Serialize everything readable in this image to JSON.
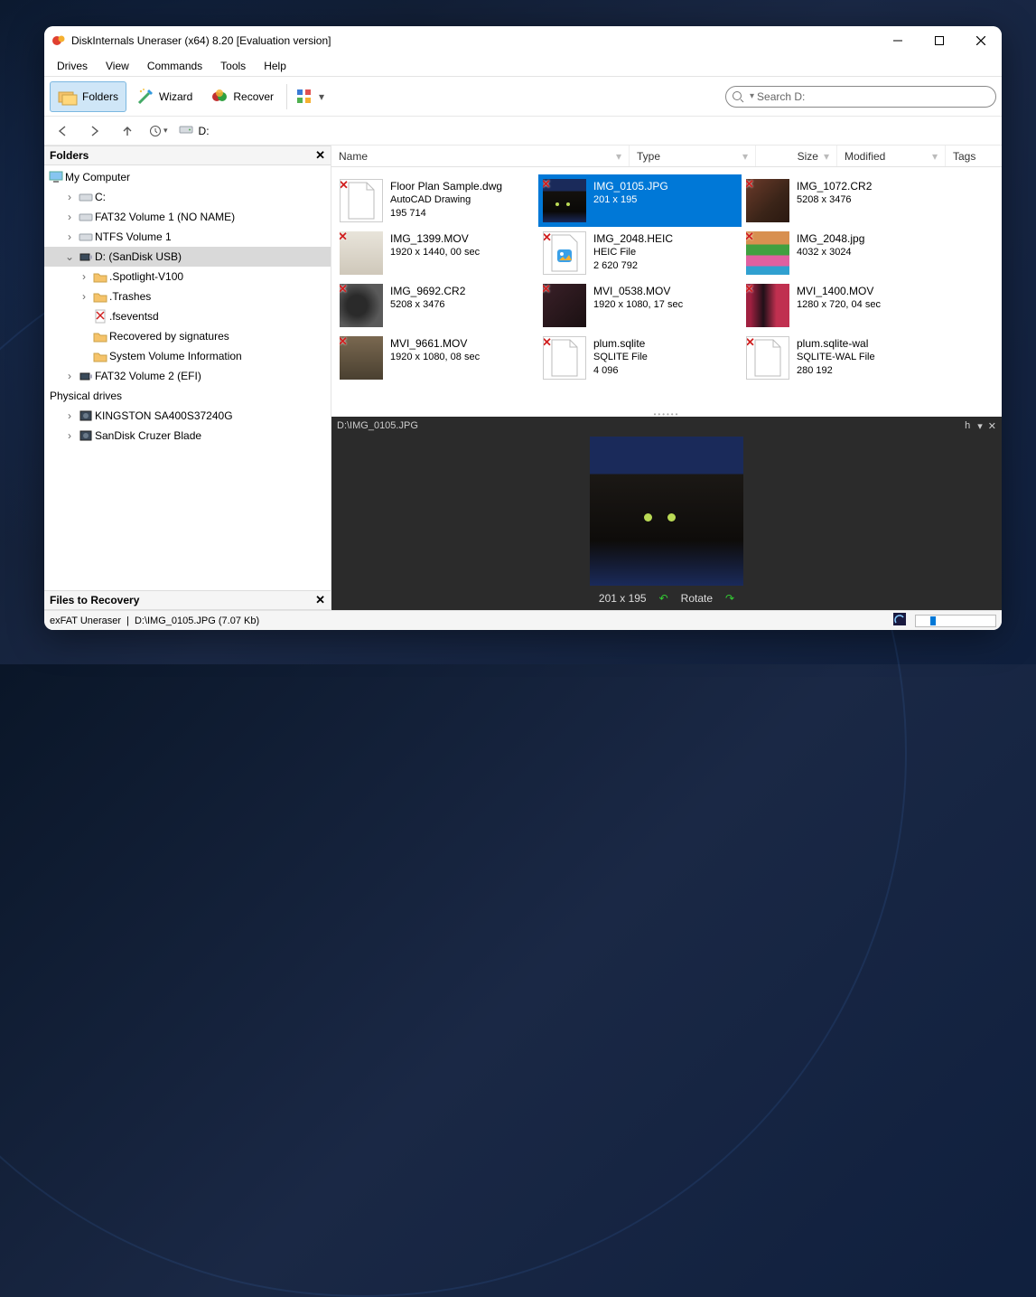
{
  "window": {
    "title": "DiskInternals Uneraser (x64) 8.20 [Evaluation version]"
  },
  "menu": {
    "drives": "Drives",
    "view": "View",
    "commands": "Commands",
    "tools": "Tools",
    "help": "Help"
  },
  "toolbar": {
    "folders": "Folders",
    "wizard": "Wizard",
    "recover": "Recover",
    "search_placeholder": "Search D:"
  },
  "nav": {
    "path": "D:"
  },
  "sidebar": {
    "folders_title": "Folders",
    "recovery_title": "Files to Recovery",
    "phys_title": "Physical drives",
    "tree": {
      "my_computer": "My Computer",
      "c": "C:",
      "fat32_v1": "FAT32 Volume 1 (NO NAME)",
      "ntfs_v1": "NTFS Volume 1",
      "d": "D: (SanDisk USB)",
      "spotlight": ".Spotlight-V100",
      "trashes": ".Trashes",
      "fseventsd": ".fseventsd",
      "sigs": "Recovered by signatures",
      "svi": "System Volume Information",
      "fat32_v2": "FAT32 Volume 2 (EFI)",
      "kingston": "KINGSTON SA400S37240G",
      "sandisk": "SanDisk Cruzer Blade"
    }
  },
  "columns": {
    "name": "Name",
    "type": "Type",
    "size": "Size",
    "modified": "Modified",
    "tags": "Tags"
  },
  "files": [
    {
      "name": "Floor Plan Sample.dwg",
      "line2": "AutoCAD Drawing",
      "line3": "195 714",
      "thumb": "doc"
    },
    {
      "name": "IMG_0105.JPG",
      "line2": "201 x 195",
      "line3": "",
      "thumb": "cat",
      "selected": true
    },
    {
      "name": "IMG_1072.CR2",
      "line2": "5208 x 3476",
      "line3": "",
      "thumb": "photo1"
    },
    {
      "name": "IMG_1399.MOV",
      "line2": "1920 x 1440, 00 sec",
      "line3": "",
      "thumb": "photo2"
    },
    {
      "name": "IMG_2048.HEIC",
      "line2": "HEIC File",
      "line3": "2 620 792",
      "thumb": "heic"
    },
    {
      "name": "IMG_2048.jpg",
      "line2": "4032 x 3024",
      "line3": "",
      "thumb": "photo3"
    },
    {
      "name": "IMG_9692.CR2",
      "line2": "5208 x 3476",
      "line3": "",
      "thumb": "photo4"
    },
    {
      "name": "MVI_0538.MOV",
      "line2": "1920 x 1080, 17 sec",
      "line3": "",
      "thumb": "photo5"
    },
    {
      "name": "MVI_1400.MOV",
      "line2": "1280 x 720, 04 sec",
      "line3": "",
      "thumb": "photo6"
    },
    {
      "name": "MVI_9661.MOV",
      "line2": "1920 x 1080, 08 sec",
      "line3": "",
      "thumb": "photo7"
    },
    {
      "name": "plum.sqlite",
      "line2": "SQLITE File",
      "line3": "4 096",
      "thumb": "doc"
    },
    {
      "name": "plum.sqlite-wal",
      "line2": "SQLITE-WAL File",
      "line3": "280 192",
      "thumb": "doc"
    }
  ],
  "preview": {
    "path": "D:\\IMG_0105.JPG",
    "dims": "201 x 195",
    "rotate": "Rotate",
    "hint": "h"
  },
  "status": {
    "prod": "exFAT Uneraser",
    "file": "D:\\IMG_0105.JPG (7.07 Kb)"
  }
}
